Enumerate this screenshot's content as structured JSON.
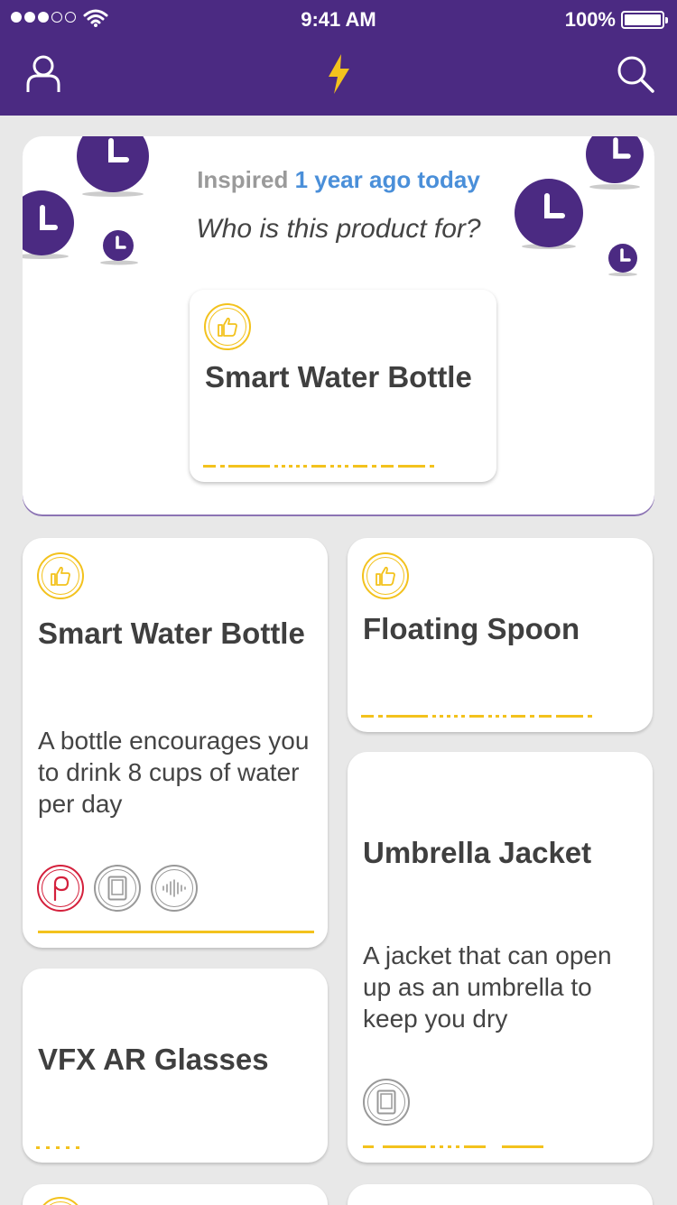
{
  "status_bar": {
    "time": "9:41 AM",
    "battery": "100%"
  },
  "nav": {
    "icons": [
      "profile-icon",
      "lightning-icon",
      "search-icon"
    ]
  },
  "hero": {
    "inspired_prefix": "Inspired",
    "inspired_highlight": "1 year ago today",
    "question": "Who is this product for?",
    "product": {
      "title": "Smart Water Bottle",
      "badge": "thumbs-up-icon"
    }
  },
  "cards": [
    {
      "title": "Smart Water Bottle",
      "description": "A bottle encourages you to drink 8 cups of water per day",
      "badge": "thumbs-up-icon",
      "channels": [
        "pinterest-icon",
        "tablet-icon",
        "audio-icon"
      ]
    },
    {
      "title": "Floating Spoon",
      "badge": "thumbs-up-icon"
    },
    {
      "title": "Umbrella Jacket",
      "description": "A jacket that can open up as an umbrella to keep you dry",
      "channels": [
        "tablet-icon"
      ]
    },
    {
      "title": "VFX AR Glasses"
    }
  ],
  "colors": {
    "brand": "#4b2a82",
    "accent": "#f3c21d",
    "link": "#4a8fd9",
    "pinterest": "#d4203c"
  }
}
